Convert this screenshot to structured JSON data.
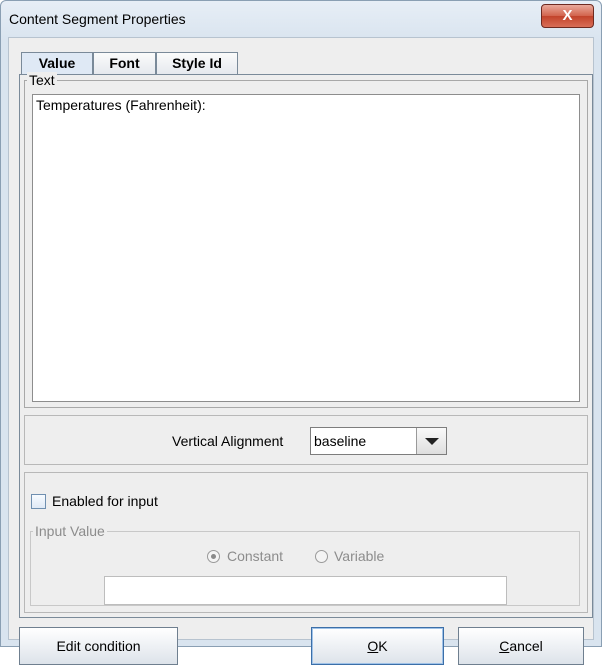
{
  "window": {
    "title": "Content Segment Properties",
    "close_label": "X"
  },
  "tabs": [
    {
      "label": "Value",
      "selected": true
    },
    {
      "label": "Font",
      "selected": false
    },
    {
      "label": "Style Id",
      "selected": false
    }
  ],
  "text_group": {
    "legend": "Text",
    "value": "Temperatures (Fahrenheit):"
  },
  "vertical_alignment": {
    "label": "Vertical Alignment",
    "value": "baseline"
  },
  "input_section": {
    "enabled_label": "Enabled for input",
    "enabled_checked": false,
    "group_legend": "Input Value",
    "radio_constant": "Constant",
    "radio_variable": "Variable",
    "selected_radio": "Constant",
    "value": ""
  },
  "buttons": {
    "edit_condition": "Edit condition",
    "ok_mnemonic": "O",
    "ok_rest": "K",
    "cancel_mnemonic": "C",
    "cancel_rest": "ancel"
  }
}
